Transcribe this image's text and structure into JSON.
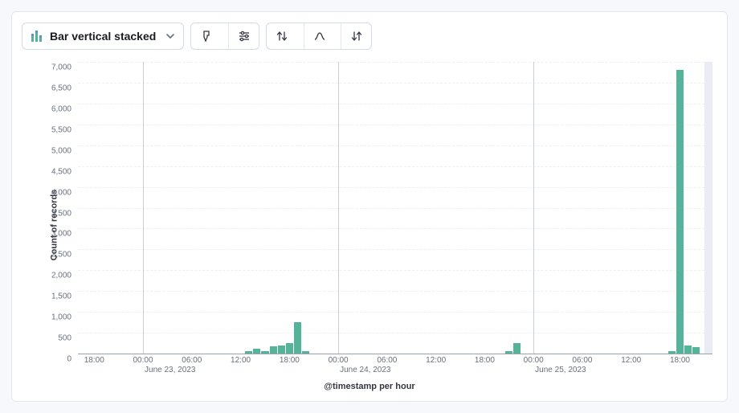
{
  "toolbar": {
    "chart_type_label": "Bar vertical stacked",
    "icons": {
      "chart_type": "bar-stacked-icon",
      "brush": "brush-icon",
      "settings": "sliders-icon",
      "sort_asc": "sort-asc-icon",
      "sort_manual": "curve-icon",
      "sort_desc": "sort-desc-icon"
    }
  },
  "chart": {
    "y_title": "Count of records",
    "x_title": "@timestamp per hour"
  },
  "chart_data": {
    "type": "bar",
    "title": "",
    "xlabel": "@timestamp per hour",
    "ylabel": "Count of records",
    "ylim": [
      0,
      7000
    ],
    "y_ticks": [
      0,
      500,
      1000,
      1500,
      2000,
      2500,
      3000,
      3500,
      4000,
      4500,
      5000,
      5500,
      6000,
      6500,
      7000
    ],
    "x_tick_labels": [
      "18:00",
      "00:00",
      "06:00",
      "12:00",
      "18:00",
      "00:00",
      "06:00",
      "12:00",
      "18:00",
      "00:00",
      "06:00",
      "12:00",
      "18:00"
    ],
    "x_tick_hours": [
      -6,
      0,
      6,
      12,
      18,
      24,
      30,
      36,
      42,
      48,
      54,
      60,
      66
    ],
    "x_range_hours": [
      -8,
      70
    ],
    "day_boundaries_hours": [
      0,
      24,
      48
    ],
    "date_labels": [
      {
        "hour": 0,
        "text": "June 23, 2023"
      },
      {
        "hour": 24,
        "text": "June 24, 2023"
      },
      {
        "hour": 48,
        "text": "June 25, 2023"
      }
    ],
    "x_hours": [
      13,
      14,
      15,
      16,
      17,
      18,
      19,
      20,
      45,
      46,
      65,
      66,
      67,
      68
    ],
    "values": [
      60,
      120,
      60,
      180,
      200,
      250,
      750,
      60,
      50,
      250,
      50,
      6800,
      200,
      150
    ],
    "bar_color": "#54b399",
    "brush_hours": [
      69,
      70
    ]
  }
}
